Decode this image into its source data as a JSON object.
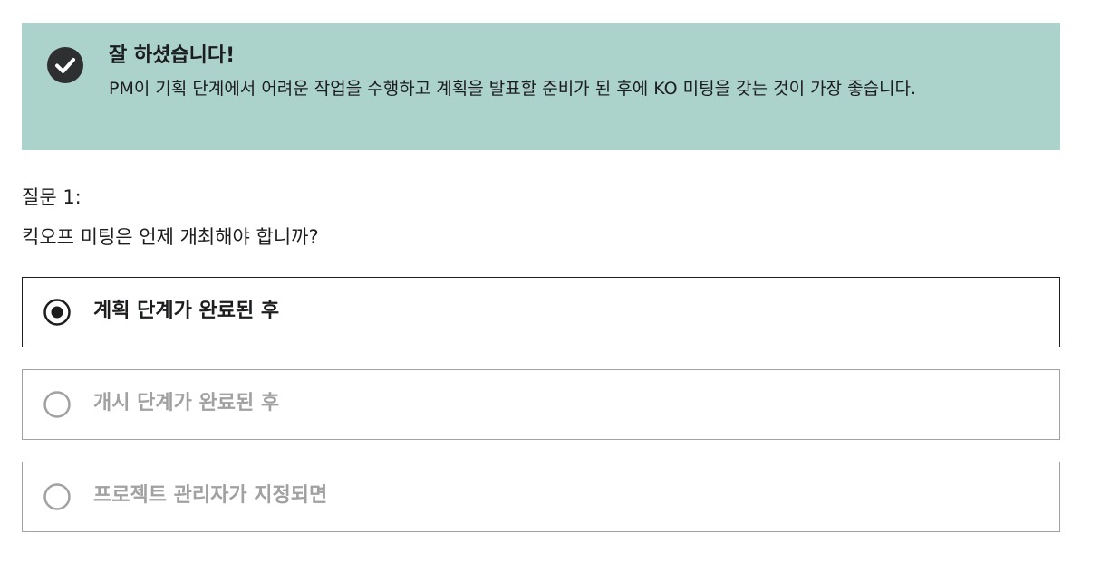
{
  "feedback": {
    "icon": "check-circle-icon",
    "title": "잘 하셨습니다!",
    "message": "PM이 기획 단계에서 어려운 작업을 수행하고 계획을 발표할 준비가 된 후에 KO 미팅을 갖는 것이 가장 좋습니다.",
    "background_color": "#acd2cc"
  },
  "question": {
    "number_label": "질문 1:",
    "text": "킥오프 미팅은 언제 개최해야 합니까?"
  },
  "options": [
    {
      "label": "계획 단계가 완료된 후",
      "selected": true
    },
    {
      "label": "개시 단계가 완료된 후",
      "selected": false
    },
    {
      "label": "프로젝트 관리자가 지정되면",
      "selected": false
    }
  ]
}
